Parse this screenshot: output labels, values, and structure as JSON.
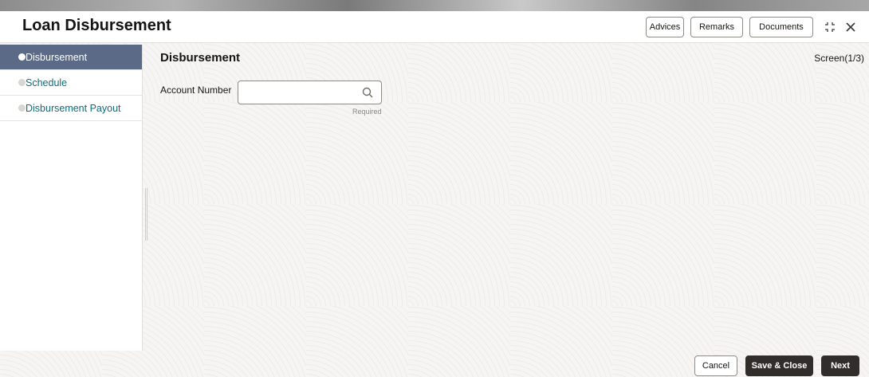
{
  "header": {
    "title": "Loan Disbursement",
    "buttons": {
      "advices": "Advices",
      "remarks": "Remarks",
      "documents": "Documents"
    },
    "icons": [
      "collapse-icon",
      "close-icon"
    ]
  },
  "sidebar": {
    "items": [
      {
        "label": "Disbursement",
        "active": true
      },
      {
        "label": "Schedule",
        "active": false
      },
      {
        "label": "Disbursement Payout",
        "active": false
      }
    ]
  },
  "main": {
    "section_title": "Disbursement",
    "screen_indicator": "Screen(1/3)",
    "account_number": {
      "label": "Account Number",
      "value": "",
      "required_text": "Required"
    }
  },
  "footer": {
    "cancel": "Cancel",
    "save_close": "Save & Close",
    "next": "Next"
  },
  "colors": {
    "sidebar_active": "#5b6a86",
    "link_teal": "#0e6d7c",
    "primary_button": "#312d2a"
  }
}
